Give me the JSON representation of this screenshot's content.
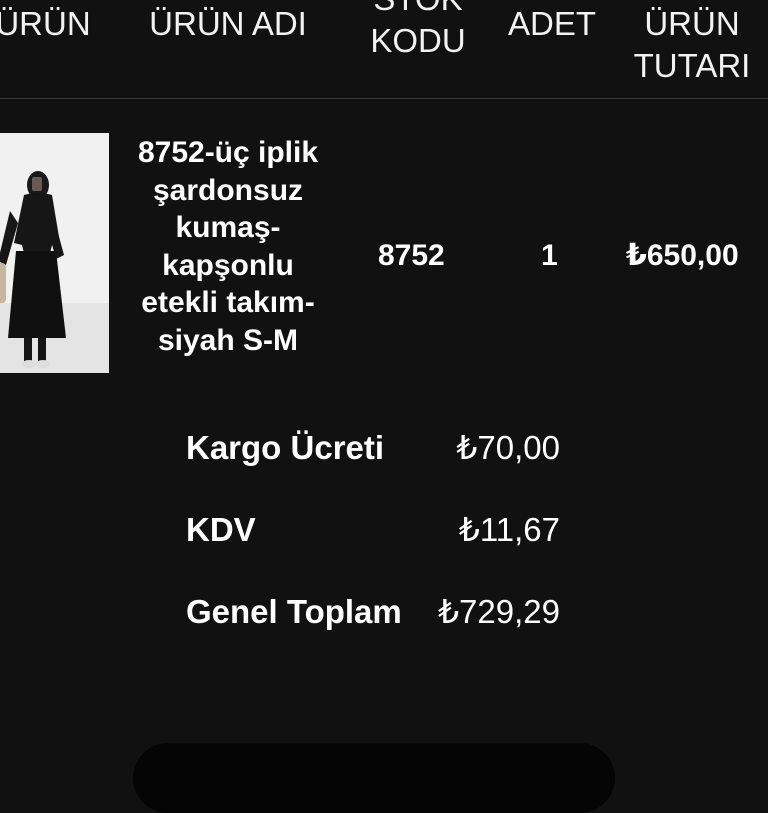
{
  "table": {
    "headers": {
      "product": "ÜRÜN",
      "product_name": "ÜRÜN ADI",
      "stock_code": "STOK KODU",
      "quantity": "ADET",
      "product_price": "ÜRÜN TUTARI"
    },
    "rows": [
      {
        "name": "8752-üç iplik şardonsuz kumaş-kapşonlu etekli takım-siyah S-M",
        "stock_code": "8752",
        "quantity": "1",
        "price": "₺650,00"
      }
    ]
  },
  "totals": {
    "shipping_label": "Kargo Ücreti",
    "shipping_value": "₺70,00",
    "vat_label": "KDV",
    "vat_value": "₺11,67",
    "grand_total_label": "Genel Toplam",
    "grand_total_value": "₺729,29"
  },
  "colors": {
    "background": "#111111",
    "text": "#ffffff",
    "divider": "#3a3a3a"
  }
}
